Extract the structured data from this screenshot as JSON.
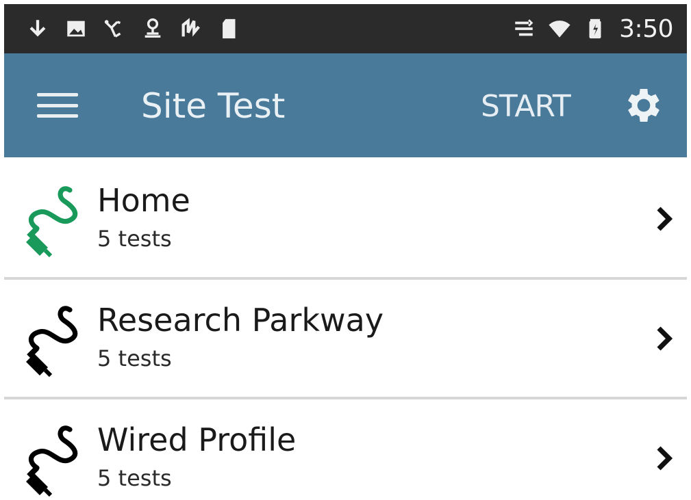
{
  "status_bar": {
    "time": "3:50",
    "left_icons": [
      "download-icon",
      "image-icon",
      "usb-icon",
      "network-test-icon",
      "cable-icon",
      "sd-card-icon"
    ],
    "right_icons": [
      "ethernet-link-icon",
      "wifi-icon",
      "battery-icon"
    ]
  },
  "app_bar": {
    "title": "Site Test",
    "start_label": "START",
    "menu_icon": "hamburger-menu-icon",
    "settings_icon": "gear-icon",
    "color": "#4a7a9a"
  },
  "profiles": [
    {
      "title": "Home",
      "subtitle": "5 tests",
      "icon": "ethernet-cable-icon",
      "icon_color": "#1a9a5a"
    },
    {
      "title": "Research Parkway",
      "subtitle": "5 tests",
      "icon": "ethernet-cable-icon",
      "icon_color": "#000000"
    },
    {
      "title": "Wired Profile",
      "subtitle": "5 tests",
      "icon": "ethernet-cable-icon",
      "icon_color": "#000000"
    }
  ]
}
